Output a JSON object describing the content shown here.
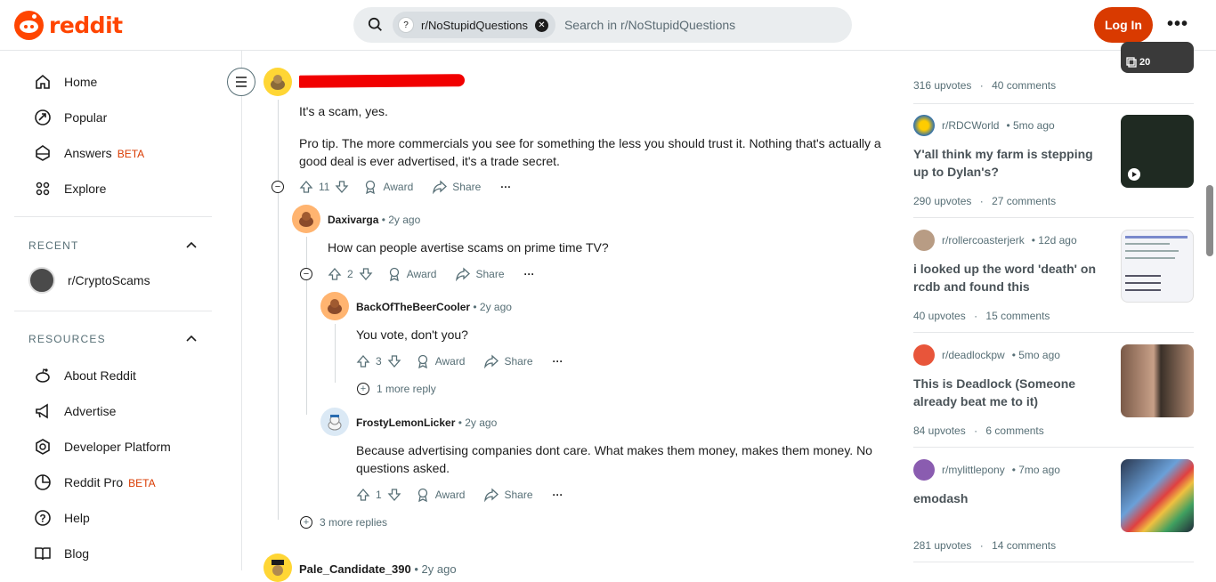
{
  "header": {
    "logo_text": "reddit",
    "search_chip": "r/NoStupidQuestions",
    "search_placeholder": "Search in r/NoStupidQuestions",
    "login_label": "Log In",
    "more_label": "•••"
  },
  "sidebar": {
    "nav": [
      {
        "label": "Home",
        "icon": "home-icon"
      },
      {
        "label": "Popular",
        "icon": "popular-icon"
      },
      {
        "label": "Answers",
        "icon": "answers-icon",
        "badge": "BETA"
      },
      {
        "label": "Explore",
        "icon": "explore-icon"
      }
    ],
    "recent_heading": "RECENT",
    "recent": [
      {
        "label": "r/CryptoScams"
      }
    ],
    "resources_heading": "RESOURCES",
    "resources": [
      {
        "label": "About Reddit",
        "icon": "reddit-alien-icon"
      },
      {
        "label": "Advertise",
        "icon": "megaphone-icon"
      },
      {
        "label": "Developer Platform",
        "icon": "developer-icon"
      },
      {
        "label": "Reddit Pro",
        "icon": "pie-chart-icon",
        "badge": "BETA"
      },
      {
        "label": "Help",
        "icon": "help-icon"
      },
      {
        "label": "Blog",
        "icon": "book-icon"
      }
    ]
  },
  "comments": [
    {
      "user": "",
      "time": "",
      "body": [
        "It's a scam, yes.",
        "Pro tip. The more commercials you see for something the less you should trust it. Nothing that's actually a good deal is ever advertised, it's a trade secret."
      ],
      "votes": "11"
    },
    {
      "user": "Daxivarga",
      "time": "• 2y ago",
      "body": [
        "How can people avertise scams on prime time TV?"
      ],
      "votes": "2"
    },
    {
      "user": "BackOfTheBeerCooler",
      "time": "• 2y ago",
      "body": [
        "You vote, don't you?"
      ],
      "votes": "3",
      "more_replies": "1 more reply"
    },
    {
      "user": "FrostyLemonLicker",
      "time": "• 2y ago",
      "body": [
        "Because advertising companies dont care. What makes them money, makes them money. No questions asked."
      ],
      "votes": "1"
    },
    {
      "user": "Pale_Candidate_390",
      "time": "• 2y ago"
    }
  ],
  "actions": {
    "award": "Award",
    "share": "Share",
    "overflow": "···"
  },
  "thread_more": "3 more replies",
  "right_rail": {
    "top_meta": {
      "upvotes": "316 upvotes",
      "comments": "40 comments",
      "gallery_count": "20"
    },
    "posts": [
      {
        "sub": "r/RDCWorld",
        "time": "• 5mo ago",
        "title": "Y'all think my farm is stepping up to Dylan's?",
        "upvotes": "290 upvotes",
        "comments": "27 comments",
        "thumb_color": "#1f2a22"
      },
      {
        "sub": "r/rollercoasterjerk",
        "time": "• 12d ago",
        "title": "i looked up the word 'death' on rcdb and found this",
        "upvotes": "40 upvotes",
        "comments": "15 comments",
        "thumb_color": "#f3f4f8"
      },
      {
        "sub": "r/deadlockpw",
        "time": "• 5mo ago",
        "title": "This is Deadlock (Someone already beat me to it)",
        "upvotes": "84 upvotes",
        "comments": "6 comments",
        "thumb_color": "#6e4b3a"
      },
      {
        "sub": "r/mylittlepony",
        "time": "• 7mo ago",
        "title": "emodash",
        "upvotes": "281 upvotes",
        "comments": "14 comments",
        "thumb_color": "#3a4a6a"
      }
    ],
    "separator": "·"
  },
  "colors": {
    "brand": "#ff4500",
    "login": "#d93a00",
    "beta": "#d93a00",
    "redaction": "#f10000"
  }
}
